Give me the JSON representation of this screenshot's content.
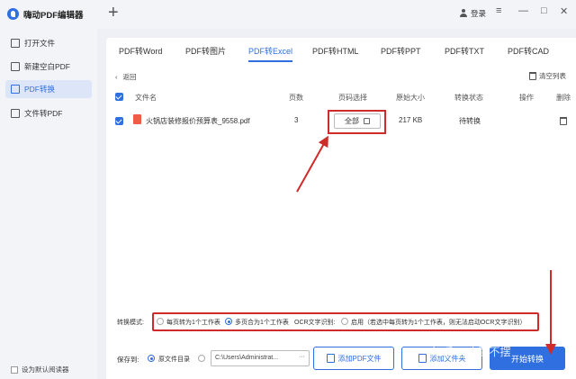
{
  "app": {
    "title": "嗨动PDF编辑器",
    "login_label": "登录"
  },
  "window_controls": {
    "minimize": "—",
    "menu": "≡",
    "maximize": "□",
    "close": "✕"
  },
  "sidebar": {
    "items": [
      {
        "label": "打开文件",
        "icon": "folder-icon"
      },
      {
        "label": "新建空白PDF",
        "icon": "image-icon"
      },
      {
        "label": "PDF转换",
        "icon": "convert-icon",
        "active": true
      },
      {
        "label": "文件转PDF",
        "icon": "file-icon"
      }
    ],
    "default_reader_label": "设为默认阅读器"
  },
  "tabs": [
    "PDF转Word",
    "PDF转图片",
    "PDF转Excel",
    "PDF转HTML",
    "PDF转PPT",
    "PDF转TXT",
    "PDF转CAD"
  ],
  "active_tab": "PDF转Excel",
  "toolbar": {
    "back_label": "返回",
    "clear_label": "清空列表"
  },
  "table": {
    "headers": [
      "文件名",
      "页数",
      "页码选择",
      "原始大小",
      "转换状态",
      "操作",
      "删除"
    ],
    "rows": [
      {
        "file_name": "火锅店装修报价预算表_9558.pdf",
        "pages": "3",
        "page_select": "全部",
        "size": "217 KB",
        "status": "待转换"
      }
    ]
  },
  "mode": {
    "label": "转换模式:",
    "options": [
      {
        "label": "每页转为1个工作表",
        "selected": false
      },
      {
        "label": "多页合为1个工作表",
        "selected": true
      }
    ],
    "ocr_label": "OCR文字识别:",
    "ocr_option": "启用（若选中每页转为1个工作表，则无法启动OCR文字识别）"
  },
  "save": {
    "label": "保存到:",
    "option_label": "原文件目录",
    "path": "C:\\Users\\Administrat...",
    "path_more": "···",
    "add_file_button": "添加PDF文件",
    "add_folder_button": "添加文件夹",
    "start_button": "开始转换"
  },
  "watermark": "知乎 @小董不摆",
  "colors": {
    "accent": "#2f6fe0",
    "annotation_red": "#d02b2b"
  }
}
